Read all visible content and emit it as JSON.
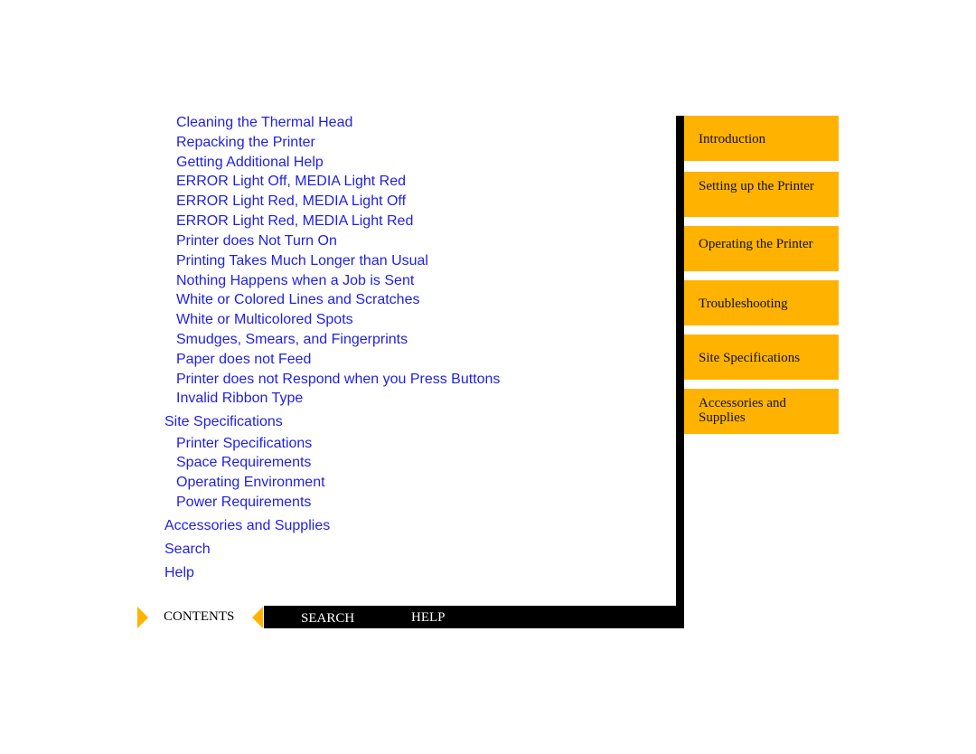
{
  "contents_links": [
    {
      "label": "Cleaning the Thermal Head",
      "level": 2
    },
    {
      "label": "Repacking the Printer",
      "level": 2
    },
    {
      "label": "Getting Additional Help",
      "level": 2
    },
    {
      "label": "ERROR Light Off, MEDIA Light Red",
      "level": 2
    },
    {
      "label": "ERROR Light Red, MEDIA Light Off",
      "level": 2
    },
    {
      "label": "ERROR Light Red, MEDIA Light Red",
      "level": 2
    },
    {
      "label": "Printer does Not Turn On",
      "level": 2
    },
    {
      "label": "Printing Takes Much Longer than Usual",
      "level": 2
    },
    {
      "label": "Nothing Happens when a Job is Sent",
      "level": 2
    },
    {
      "label": "White or Colored Lines and Scratches",
      "level": 2
    },
    {
      "label": "White or Multicolored Spots",
      "level": 2
    },
    {
      "label": "Smudges, Smears, and Fingerprints",
      "level": 2
    },
    {
      "label": "Paper does not Feed",
      "level": 2
    },
    {
      "label": "Printer does not Respond when you Press Buttons",
      "level": 2
    },
    {
      "label": "Invalid Ribbon Type",
      "level": 2
    },
    {
      "label": "Site Specifications",
      "level": 1
    },
    {
      "label": "Printer Specifications",
      "level": 2
    },
    {
      "label": "Space Requirements",
      "level": 2
    },
    {
      "label": "Operating Environment",
      "level": 2
    },
    {
      "label": "Power Requirements",
      "level": 2
    },
    {
      "label": "Accessories and Supplies",
      "level": 1
    },
    {
      "label": "Search",
      "level": 1
    },
    {
      "label": "Help",
      "level": 1
    }
  ],
  "tabs": [
    "Introduction",
    "Setting up the Printer",
    "Operating the Printer",
    "Troubleshooting",
    "Site Specifications",
    "Accessories and Supplies"
  ],
  "nav": {
    "contents": "CONTENTS",
    "search": "SEARCH",
    "help": "HELP"
  },
  "colors": {
    "link": "#1f1fe6",
    "tab": "#ffb300",
    "bar": "#000000"
  }
}
